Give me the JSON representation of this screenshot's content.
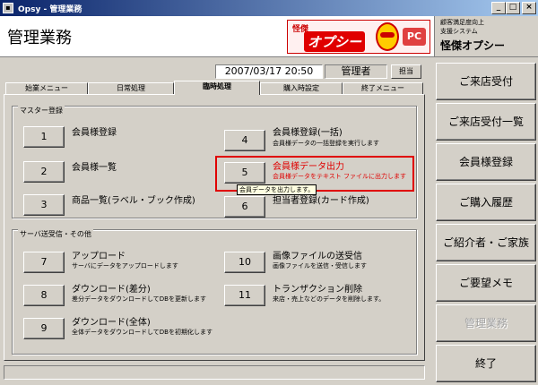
{
  "window": {
    "title": "Opsy - 管理業務",
    "app_icon": "app-icon"
  },
  "header": {
    "page_title": "管理業務",
    "logo": {
      "top": "怪傑",
      "brand": "オプシー",
      "badge": "PC"
    },
    "system": {
      "line1": "顧客満足度向上",
      "line2": "支援システム",
      "line3": "怪傑オプシー"
    }
  },
  "info": {
    "datetime": "2007/03/17 20:50",
    "user": "管理者",
    "tantou_button": "担当"
  },
  "tabs": [
    {
      "label": "始業メニュー",
      "active": false
    },
    {
      "label": "日常処理",
      "active": false
    },
    {
      "label": "臨時処理",
      "active": true
    },
    {
      "label": "購入時設定",
      "active": false
    },
    {
      "label": "終了メニュー",
      "active": false
    }
  ],
  "master": {
    "title": "マスター登録",
    "items": [
      {
        "num": "1",
        "title": "会員様登録",
        "desc": ""
      },
      {
        "num": "2",
        "title": "会員様一覧",
        "desc": ""
      },
      {
        "num": "3",
        "title": "商品一覧(ラベル・ブック作成)",
        "desc": ""
      },
      {
        "num": "4",
        "title": "会員様登録(一括)",
        "desc": "会員様データの一括登録を実行します"
      },
      {
        "num": "5",
        "title": "会員様データ出力",
        "desc": "会員様データをテキスト ファイルに出力します"
      },
      {
        "num": "6",
        "title": "担当者登録(カード作成)",
        "desc": ""
      }
    ],
    "tooltip": "会員データを出力します。"
  },
  "server": {
    "title": "サーバ送受信・その他",
    "items": [
      {
        "num": "7",
        "title": "アップロード",
        "desc": "サーバにデータをアップロードします"
      },
      {
        "num": "8",
        "title": "ダウンロード(差分)",
        "desc": "差分データをダウンロードしてDBを更新します"
      },
      {
        "num": "9",
        "title": "ダウンロード(全体)",
        "desc": "全体データをダウンロードしてDBを初期化します"
      },
      {
        "num": "10",
        "title": "画像ファイルの送受信",
        "desc": "画像ファイルを送信・受信します"
      },
      {
        "num": "11",
        "title": "トランザクション削除",
        "desc": "来店・売上などのデータを削除します。"
      }
    ]
  },
  "menu": [
    {
      "label": "ご来店受付",
      "enabled": true
    },
    {
      "label": "ご来店受付一覧",
      "enabled": true
    },
    {
      "label": "会員様登録",
      "enabled": true
    },
    {
      "label": "ご購入履歴",
      "enabled": true
    },
    {
      "label": "ご紹介者・ご家族",
      "enabled": true
    },
    {
      "label": "ご要望メモ",
      "enabled": true
    },
    {
      "label": "管理業務",
      "enabled": false
    },
    {
      "label": "終了",
      "enabled": true
    }
  ],
  "colors": {
    "highlight": "#e00000",
    "title_bar": "#0a246a"
  }
}
